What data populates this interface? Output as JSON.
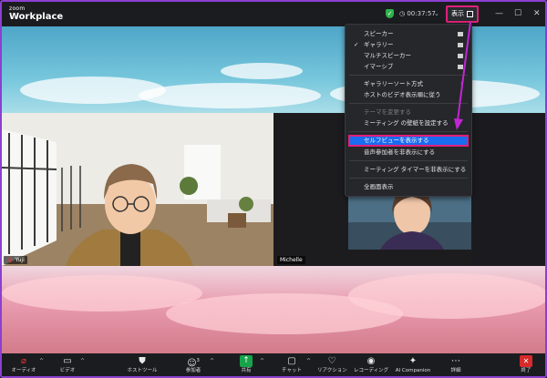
{
  "app": {
    "logo_small": "zoom",
    "logo_name": "Workplace"
  },
  "header": {
    "timer": "00:37:57",
    "view_button_label": "表示"
  },
  "colors": {
    "accent": "#1a6cf0",
    "highlight": "#e0207a",
    "pointer": "#c026d3",
    "share": "#16a34a",
    "end": "#d72a2a"
  },
  "menu": {
    "layouts": [
      {
        "label": "スピーカー",
        "checked": false,
        "icon": "speaker-layout-icon"
      },
      {
        "label": "ギャラリー",
        "checked": true,
        "icon": "gallery-layout-icon"
      },
      {
        "label": "マルチスピーカー",
        "checked": false,
        "icon": "multi-speaker-layout-icon"
      },
      {
        "label": "イマーシブ",
        "checked": false,
        "icon": "immersive-layout-icon"
      }
    ],
    "gallery_sort": "ギャラリーソート方式",
    "follow_host": "ホストのビデオ表示順に従う",
    "change_theme": "テーマを変更する",
    "set_wallpaper": "ミーティング の壁紙を設定する",
    "show_self_view": "セルフビューを表示する",
    "hide_audio_participants": "音声参加者を非表示にする",
    "hide_timer": "ミーティング タイマーを非表示にする",
    "fullscreen": "全画面表示"
  },
  "participants": [
    {
      "name": "Yuji"
    },
    {
      "name": "Michelle"
    }
  ],
  "toolbar": {
    "audio": "オーディオ",
    "video": "ビデオ",
    "host_tools": "ホストツール",
    "participants": "参加者",
    "participants_count": "3",
    "share": "共有",
    "chat": "チャット",
    "reactions": "リアクション",
    "record": "レコーディング",
    "ai_companion": "AI Companion",
    "more": "詳細",
    "end": "終了"
  }
}
